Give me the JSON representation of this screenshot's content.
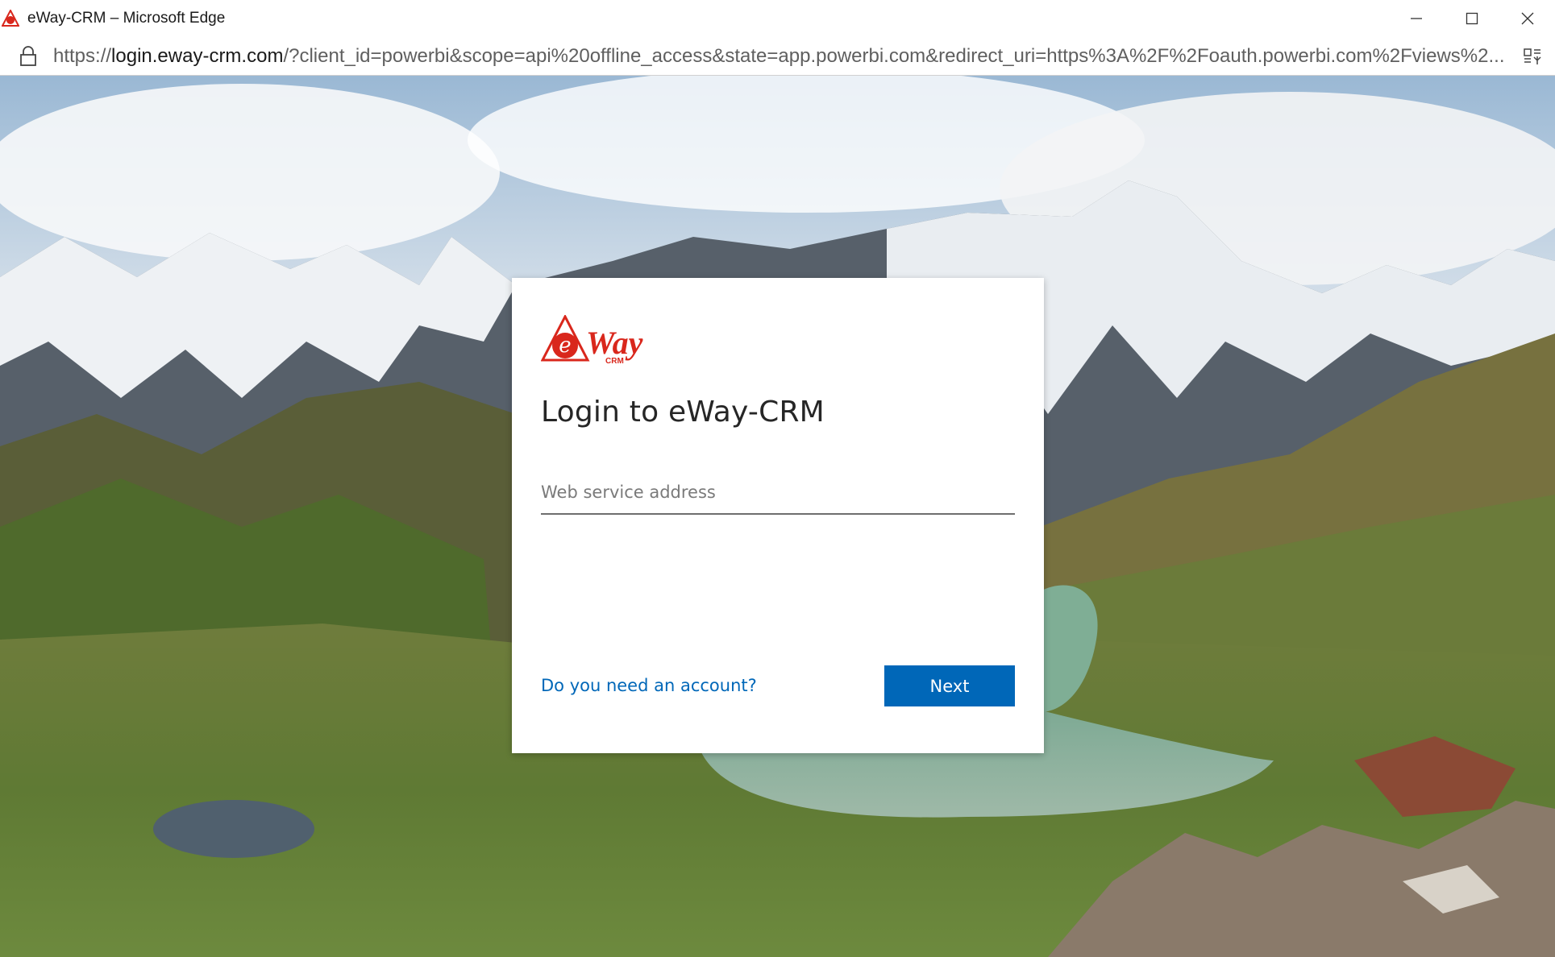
{
  "window": {
    "title": "eWay-CRM – Microsoft Edge",
    "controls": [
      "minimize",
      "maximize",
      "close"
    ]
  },
  "address_bar": {
    "url_scheme": "https://",
    "url_host": "login.eway-crm.com",
    "url_rest": "/?client_id=powerbi&scope=api%20offline_access&state=app.powerbi.com&redirect_uri=https%3A%2F%2Foauth.powerbi.com%2Fviews%2..."
  },
  "login": {
    "logo_text": "eWay",
    "logo_subtext": "CRM",
    "heading": "Login to eWay-CRM",
    "input_placeholder": "Web service address",
    "input_value": "",
    "account_link": "Do you need an account?",
    "next_label": "Next"
  },
  "colors": {
    "accent": "#0067b8",
    "brand_red": "#d9271c"
  },
  "icons": {
    "app": "eway-logo-icon",
    "lock": "lock-icon",
    "reader": "reading-view-icon"
  }
}
